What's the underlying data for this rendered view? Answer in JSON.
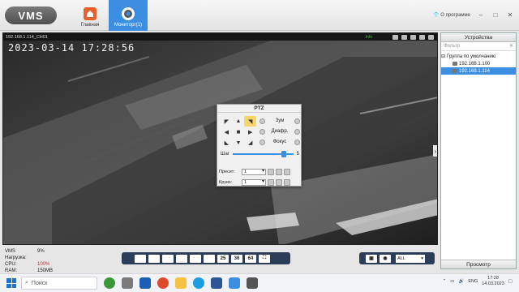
{
  "app": {
    "logo": "VMS",
    "nav": [
      {
        "label": "Главная"
      },
      {
        "label": "Мониторг(1)"
      }
    ],
    "about_label": "О программе"
  },
  "video": {
    "channel_label": "192.168.1.114_CH01",
    "status_text": "Info",
    "osd_timestamp": "2023-03-14  17:28:56"
  },
  "ptz": {
    "title": "PTZ",
    "zoom_label": "Зум",
    "iris_label": "Диафр.",
    "focus_label": "Фокус",
    "step_label": "Шаг",
    "step_value": "5",
    "step_level": 0.8,
    "preset_label": "Пресет:",
    "preset_value": "1",
    "cruise_label": "Круиз:",
    "cruise_value": "1"
  },
  "stats": {
    "vms_label": "VMS Нагрузка:",
    "vms_value": "9%",
    "cpu_label": "CPU:",
    "cpu_value": "100%",
    "ram_label": "RAM:",
    "ram_value": "150MB"
  },
  "layout_bar": {
    "buttons": [
      "",
      "",
      "",
      "",
      "",
      "",
      "25",
      "36",
      "64",
      ""
    ]
  },
  "right_bar": {
    "select_value": "ALL"
  },
  "devices": {
    "title": "Устройства",
    "filter_placeholder": "Фильтр",
    "group": "Группа по умолчанию",
    "items": [
      {
        "label": "192.168.1.100"
      },
      {
        "label": "192.168.1.114"
      }
    ],
    "bottom_tab": "Просмотр"
  },
  "taskbar": {
    "search_label": "Поиск",
    "lang": "ENG",
    "time": "17:28",
    "date": "14.03.2023"
  },
  "colors": {
    "accent": "#3c8fe0",
    "toolbar": "#2c3e57",
    "cpu_alert": "#dd2222"
  }
}
